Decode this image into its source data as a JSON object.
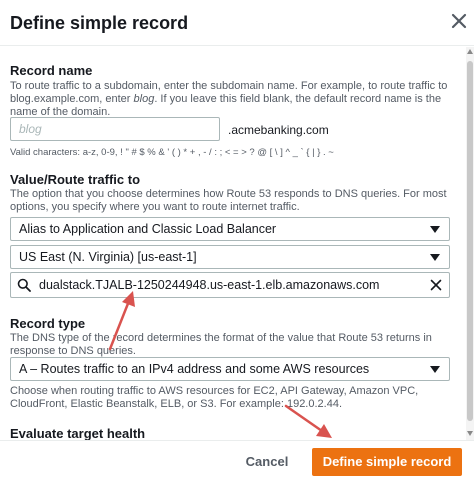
{
  "dialog": {
    "title": "Define simple record"
  },
  "record_name": {
    "label": "Record name",
    "description_1": "To route traffic to a subdomain, enter the subdomain name. For example, to route traffic to blog.example.com, enter ",
    "description_em": "blog",
    "description_2": ". If you leave this field blank, the default record name is the name of the domain.",
    "placeholder": "blog",
    "domain_suffix": ".acmebanking.com",
    "valid_chars": "Valid characters: a-z, 0-9, ! \" # $ % & ' ( ) * + , - / : ; < = > ? @ [ \\ ] ^ _ ` { | } . ~"
  },
  "value_route": {
    "label": "Value/Route traffic to",
    "description": "The option that you choose determines how Route 53 responds to DNS queries. For most options, you specify where you want to route internet traffic.",
    "endpoint_select": "Alias to Application and Classic Load Balancer",
    "region_select": "US East (N. Virginia) [us-east-1]",
    "load_balancer_value": "dualstack.TJALB-1250244948.us-east-1.elb.amazonaws.com"
  },
  "record_type": {
    "label": "Record type",
    "description": "The DNS type of the record determines the format of the value that Route 53 returns in response to DNS queries.",
    "selected": "A – Routes traffic to an IPv4 address and some AWS resources",
    "hint": "Choose when routing traffic to AWS resources for EC2, API Gateway, Amazon VPC, CloudFront, Elastic Beanstalk, ELB, or S3. For example: 192.0.2.44."
  },
  "evaluate_target_health": {
    "label": "Evaluate target health"
  },
  "footer": {
    "cancel_label": "Cancel",
    "primary_label": "Define simple record"
  },
  "colors": {
    "primary": "#ec7211",
    "annotation_arrow": "#d9534f",
    "text": "#16191f",
    "muted": "#545b64",
    "border": "#aab7b8"
  }
}
